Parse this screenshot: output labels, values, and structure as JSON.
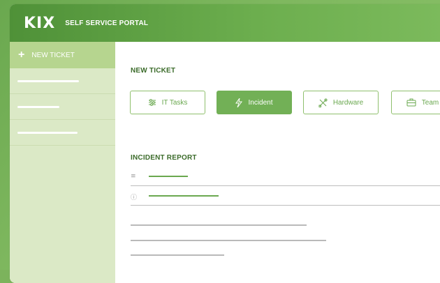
{
  "header": {
    "logo": "KIX",
    "title": "SELF SERVICE PORTAL"
  },
  "sidebar": {
    "new_ticket_label": "NEW TICKET",
    "items": [
      "",
      "",
      ""
    ]
  },
  "main": {
    "new_ticket_title": "NEW TICKET",
    "tiles": [
      {
        "label": "IT Tasks",
        "icon": "sliders-icon",
        "active": false
      },
      {
        "label": "Incident",
        "icon": "bolt-icon",
        "active": true
      },
      {
        "label": "Hardware",
        "icon": "tools-icon",
        "active": false
      },
      {
        "label": "Team",
        "icon": "briefcase-icon",
        "active": false
      }
    ],
    "report_title": "INCIDENT REPORT",
    "fields": [
      {
        "icon": "database-icon",
        "glyph": "≡"
      },
      {
        "icon": "info-icon",
        "glyph": "ⓘ"
      }
    ]
  },
  "colors": {
    "brand": "#6aa84f",
    "sidebar": "#dbe9c6",
    "accent_tile": "#72b056"
  }
}
